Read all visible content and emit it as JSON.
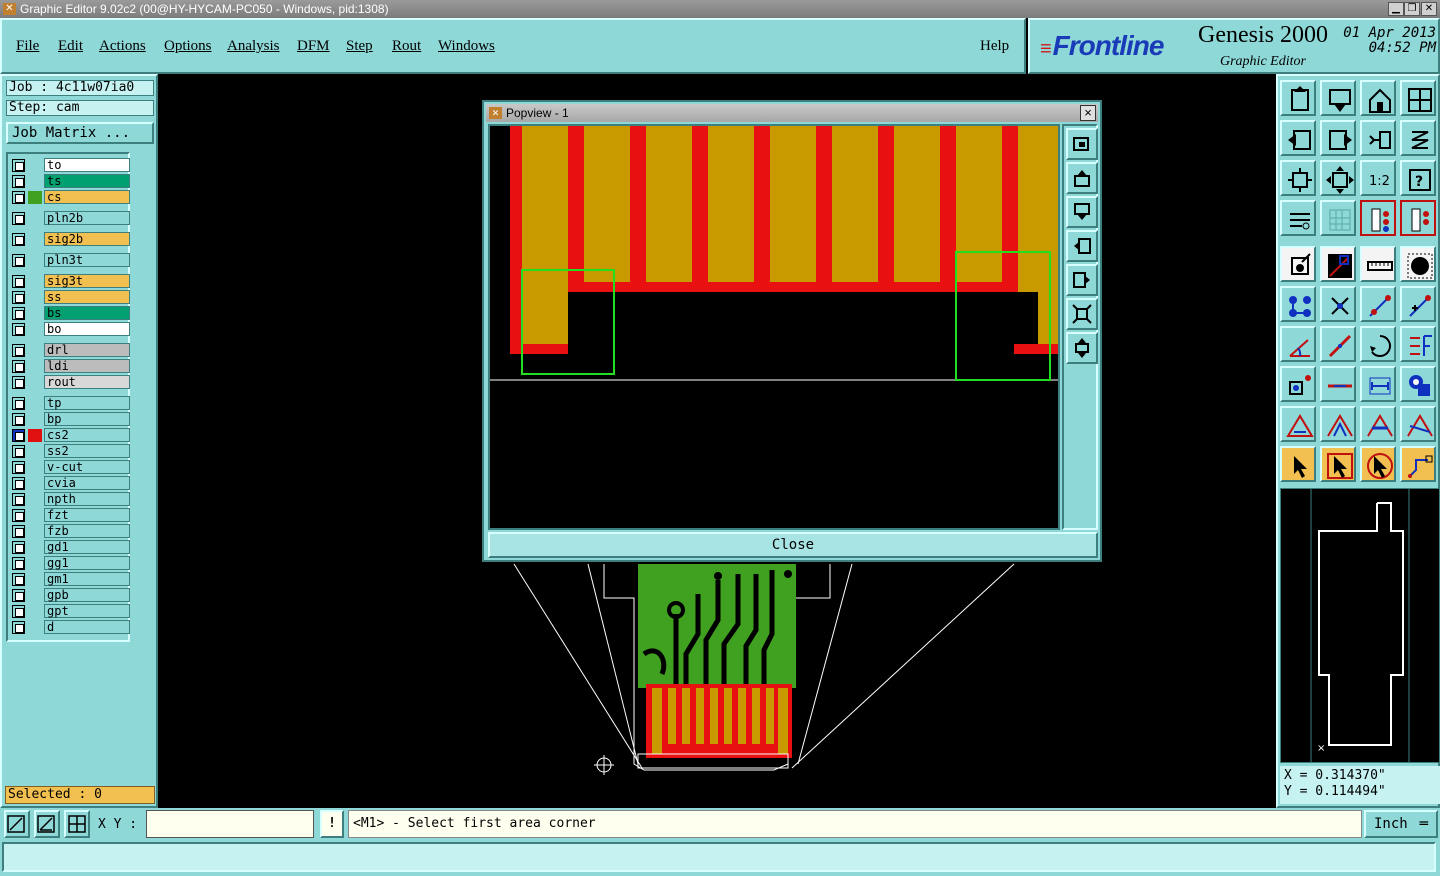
{
  "window": {
    "title": "Graphic Editor 9.02c2 (00@HY-HYCAM-PC050 - Windows, pid:1308)"
  },
  "menu": [
    {
      "label": "File"
    },
    {
      "label": "Edit"
    },
    {
      "label": "Actions"
    },
    {
      "label": "Options"
    },
    {
      "label": "Analysis"
    },
    {
      "label": "DFM"
    },
    {
      "label": "Step"
    },
    {
      "label": "Rout"
    },
    {
      "label": "Windows"
    },
    {
      "label": "Help"
    }
  ],
  "logo": {
    "brand": "Frontline",
    "product": "Genesis 2000",
    "subtitle": "Graphic Editor",
    "date": "01 Apr 2013",
    "time": "04:52 PM"
  },
  "job": {
    "job_label": "Job : 4c11w07ia0",
    "step_label": "Step: cam",
    "matrix_button": "Job Matrix ..."
  },
  "layers": [
    {
      "name": "to",
      "color": "#ffffff"
    },
    {
      "name": "ts",
      "color": "#00a070"
    },
    {
      "name": "cs",
      "color": "#f2c050",
      "swatch": "#40a020"
    },
    {
      "name": "pln2b",
      "color": "#8fd8d8"
    },
    {
      "name": "sig2b",
      "color": "#f2c050"
    },
    {
      "name": "pln3t",
      "color": "#8fd8d8"
    },
    {
      "name": "sig3t",
      "color": "#f2c050"
    },
    {
      "name": "ss",
      "color": "#f2c050"
    },
    {
      "name": "bs",
      "color": "#00a070"
    },
    {
      "name": "bo",
      "color": "#ffffff"
    },
    {
      "name": "drl",
      "color": "#bcbcbc"
    },
    {
      "name": "ldi",
      "color": "#bcbcbc"
    },
    {
      "name": "rout",
      "color": "#d8d8d8"
    },
    {
      "name": "tp",
      "color": "#8fd8d8"
    },
    {
      "name": "bp",
      "color": "#8fd8d8"
    },
    {
      "name": "cs2",
      "color": "#8fd8d8",
      "swatch": "#e01010",
      "active": true
    },
    {
      "name": "ss2",
      "color": "#8fd8d8"
    },
    {
      "name": "v-cut",
      "color": "#8fd8d8"
    },
    {
      "name": "cvia",
      "color": "#8fd8d8"
    },
    {
      "name": "npth",
      "color": "#8fd8d8"
    },
    {
      "name": "fzt",
      "color": "#8fd8d8"
    },
    {
      "name": "fzb",
      "color": "#8fd8d8"
    },
    {
      "name": "gd1",
      "color": "#8fd8d8"
    },
    {
      "name": "gg1",
      "color": "#8fd8d8"
    },
    {
      "name": "gm1",
      "color": "#8fd8d8"
    },
    {
      "name": "gpb",
      "color": "#8fd8d8"
    },
    {
      "name": "gpt",
      "color": "#8fd8d8"
    },
    {
      "name": "d",
      "color": "#8fd8d8"
    }
  ],
  "selected": "Selected : 0",
  "popview": {
    "title": "Popview - 1",
    "close_label": "Close"
  },
  "coords": {
    "x": "X = 0.314370\"",
    "y": "Y = 0.114494\""
  },
  "bottom": {
    "xy_label": "X Y :",
    "xy_value": "",
    "excl": "!",
    "prompt": "<M1> - Select first area corner",
    "unit": "Inch"
  },
  "tools": [
    "zoom-home-icon",
    "zoom-fit-icon",
    "home-icon",
    "split-view-icon",
    "pan-left-icon",
    "pan-right-icon",
    "zoom-1-0-icon",
    "s-curve-icon",
    "fit-all-icon",
    "fit-center-icon",
    "scale-1-2-icon",
    "help-icon",
    "properties-icon",
    "grid-icon",
    "snap-layer-icon",
    "snap-red-icon",
    "feature-info-icon",
    "measure-icon",
    "ruler-icon",
    "pad-icon",
    "net-icon",
    "delete-icon",
    "move-point-icon",
    "add-point-icon",
    "angle-icon",
    "line-icon",
    "arc-icon",
    "text-icon",
    "select-pad-icon",
    "horizontal-line-icon",
    "dimension-icon",
    "shapes-icon",
    "triangle-icon",
    "triangle-select-icon",
    "triangle-area-icon",
    "triangle-cut-icon",
    "pointer-icon",
    "pointer-box-icon",
    "pointer-circle-icon",
    "route-icon"
  ],
  "colors": {
    "panel": "#8fd8d8",
    "copper": "#c89a00",
    "mask": "#e81010",
    "board": "#40a020",
    "highlight": "#20e020"
  }
}
